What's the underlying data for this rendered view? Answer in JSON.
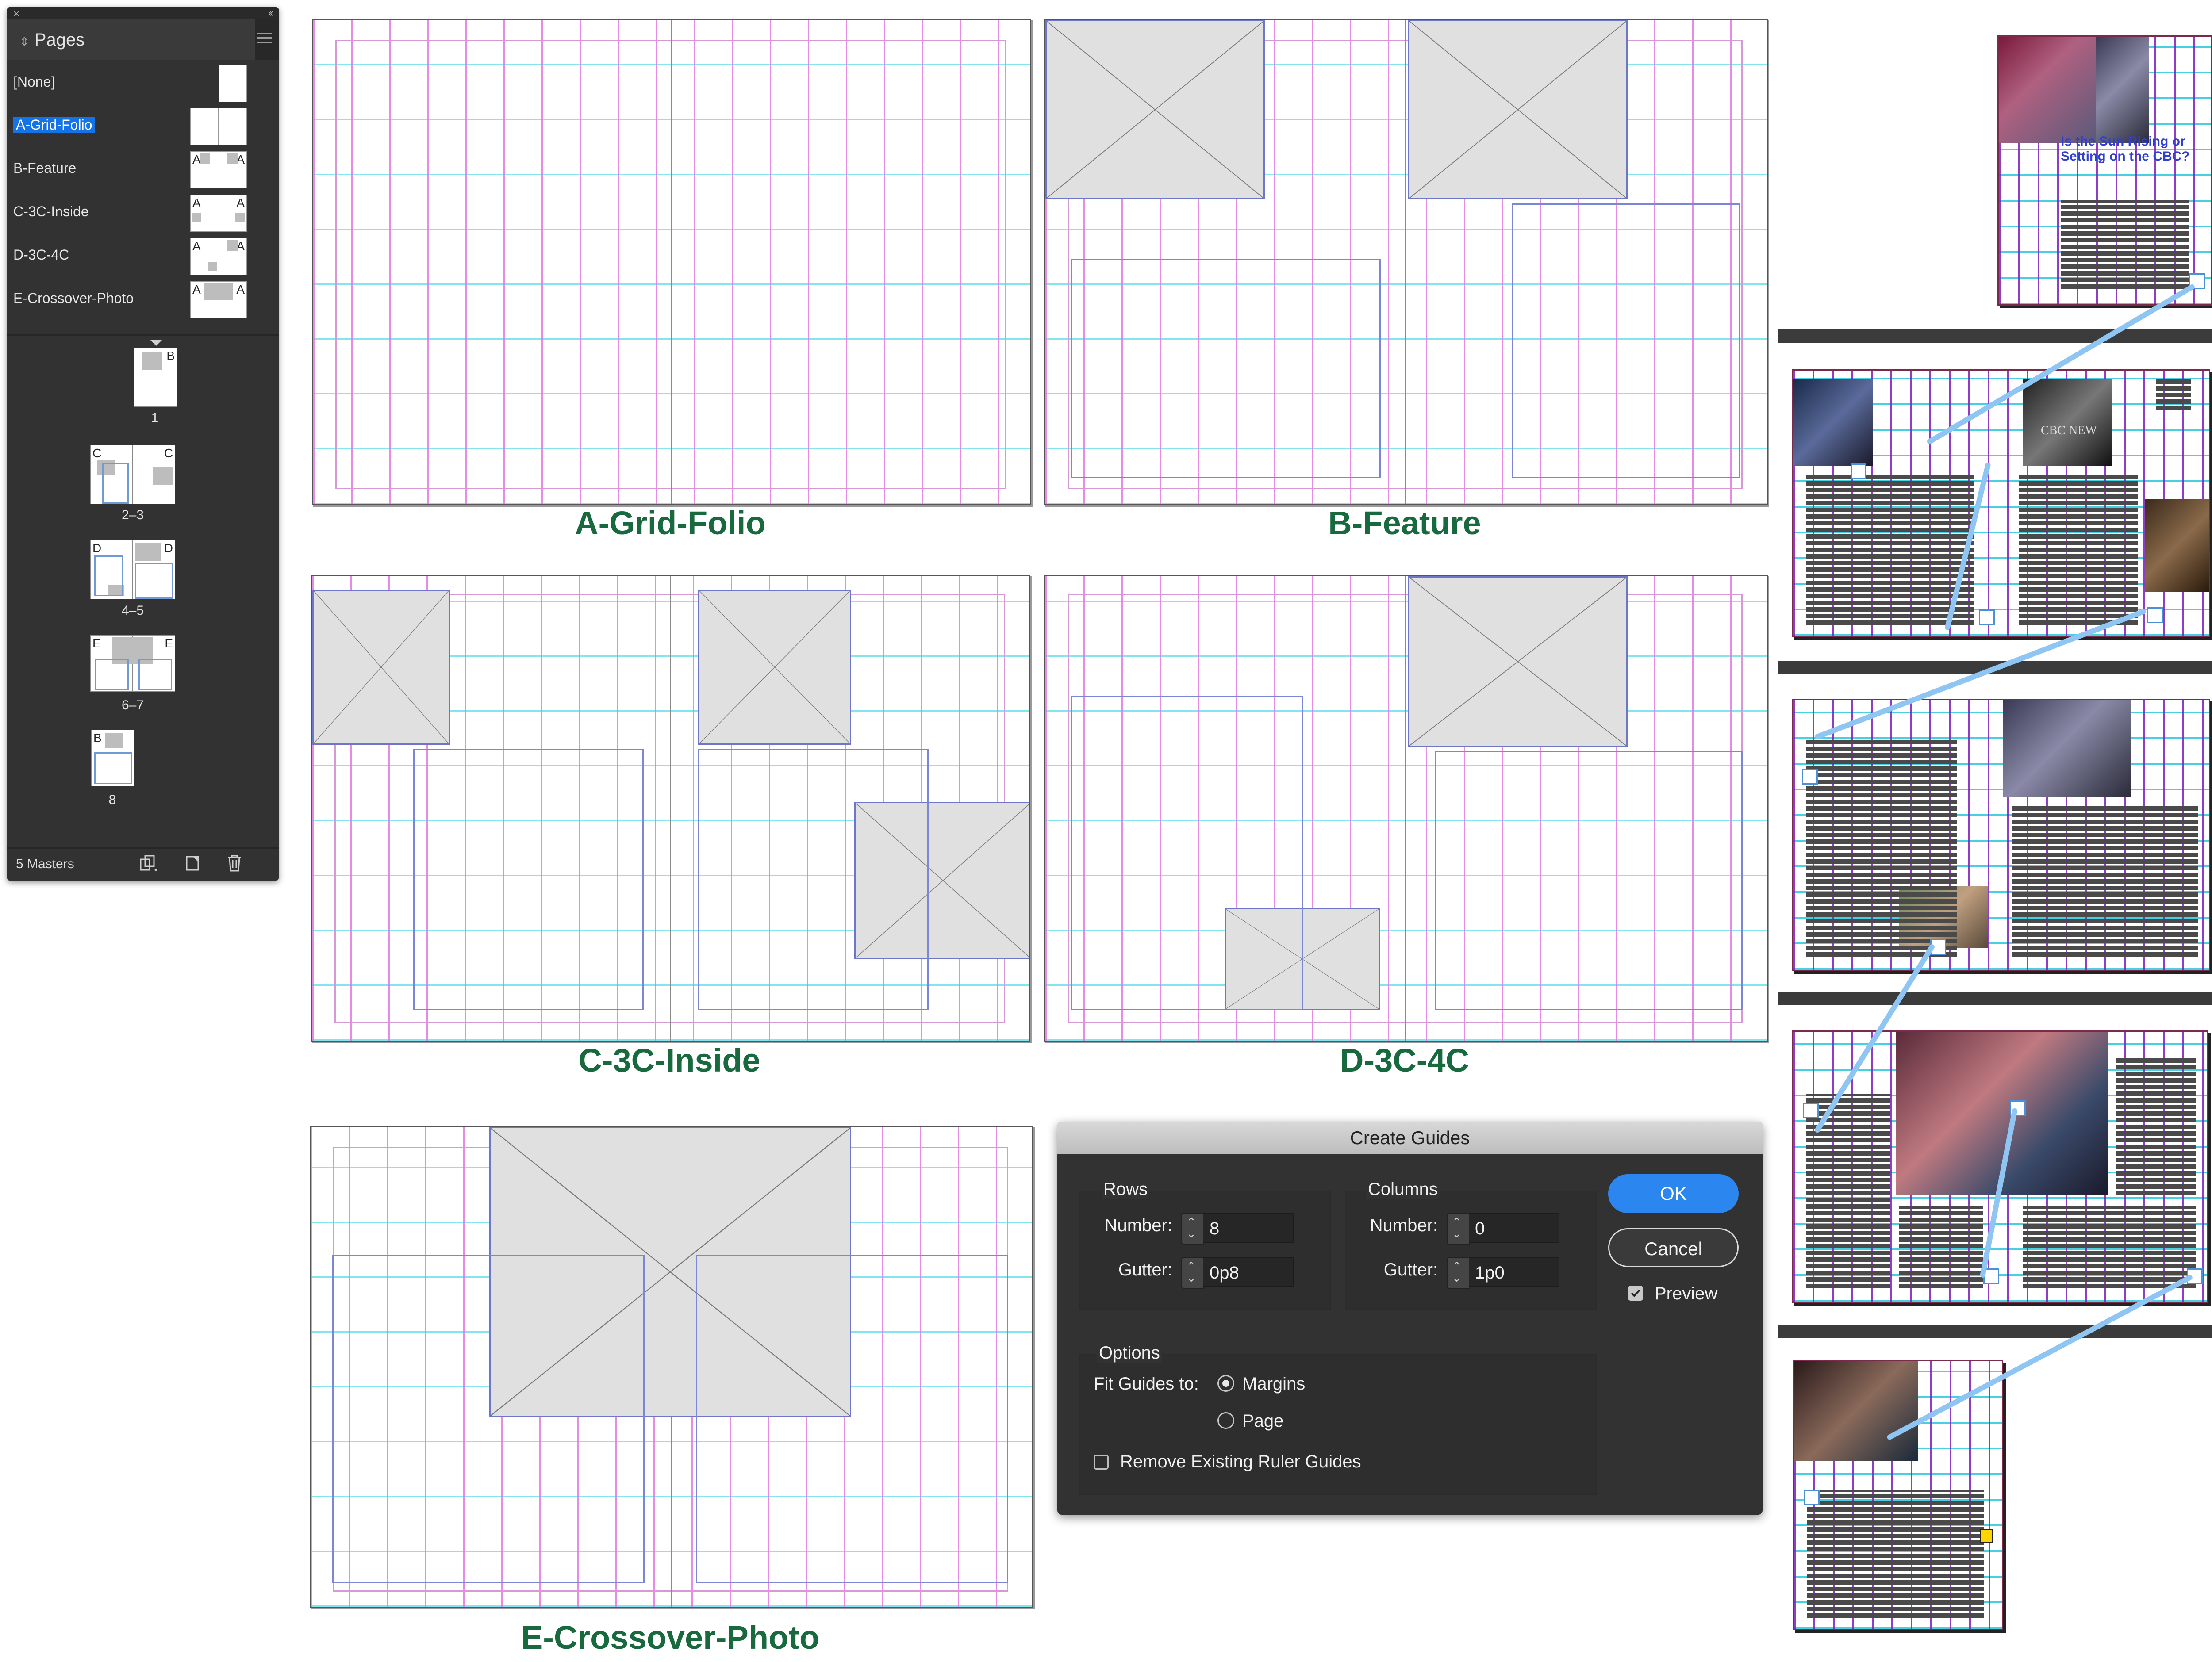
{
  "pages_panel": {
    "tab_title": "Pages",
    "masters": [
      {
        "label": "[None]",
        "letter_left": "",
        "letter_right": ""
      },
      {
        "label": "A-Grid-Folio",
        "letter_left": "",
        "letter_right": ""
      },
      {
        "label": "B-Feature",
        "letter_left": "A",
        "letter_right": "A"
      },
      {
        "label": "C-3C-Inside",
        "letter_left": "A",
        "letter_right": "A"
      },
      {
        "label": "D-3C-4C",
        "letter_left": "A",
        "letter_right": "A"
      },
      {
        "label": "E-Crossover-Photo",
        "letter_left": "A",
        "letter_right": "A"
      }
    ],
    "pages": [
      {
        "number": "1",
        "letter_left": "",
        "letter_right": "B"
      },
      {
        "number": "2–3",
        "letter_left": "C",
        "letter_right": "C"
      },
      {
        "number": "4–5",
        "letter_left": "D",
        "letter_right": "D"
      },
      {
        "number": "6–7",
        "letter_left": "E",
        "letter_right": "E"
      },
      {
        "number": "8",
        "letter_left": "B",
        "letter_right": ""
      }
    ],
    "footer": {
      "masters_count": "5 Masters"
    },
    "icons": [
      "close-icon",
      "collapse-icon",
      "panel-menu-icon",
      "edit-page-size-icon",
      "new-page-icon",
      "trash-icon"
    ]
  },
  "spread_titles": {
    "a": "A-Grid-Folio",
    "b": "B-Feature",
    "c": "C-3C-Inside",
    "d": "D-3C-4C",
    "e": "E-Crossover-Photo"
  },
  "dialog": {
    "title": "Create Guides",
    "rows": {
      "title": "Rows",
      "number_label": "Number:",
      "number_value": "8",
      "gutter_label": "Gutter:",
      "gutter_value": "0p8"
    },
    "columns": {
      "title": "Columns",
      "number_label": "Number:",
      "number_value": "0",
      "gutter_label": "Gutter:",
      "gutter_value": "1p0"
    },
    "ok_label": "OK",
    "cancel_label": "Cancel",
    "preview_label": "Preview",
    "preview_checked": true,
    "options": {
      "title": "Options",
      "fit_label": "Fit Guides to:",
      "margins_label": "Margins",
      "page_label": "Page",
      "selected": "Margins",
      "remove_label": "Remove Existing Ruler Guides",
      "remove_checked": false
    }
  },
  "previews": {
    "headline": "Is the Sun Rising or Setting on the CBC?",
    "photo_caption": "CBC NEW"
  },
  "colors": {
    "title_green": "#19693f",
    "ok_blue": "#2b86f0",
    "selection_blue": "#1473e6",
    "thread_blue": "#8ec5f2"
  }
}
